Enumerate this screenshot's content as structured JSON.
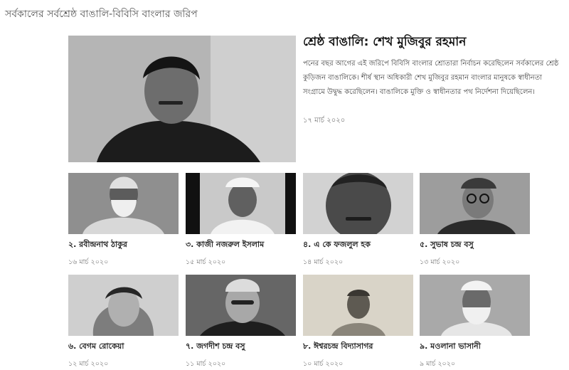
{
  "section": {
    "title": "সর্বকালের সর্বশ্রেষ্ঠ বাঙালি-বিবিসি বাংলার জরিপ"
  },
  "featured": {
    "title": "শ্রেষ্ঠ বাঙালি: শেখ মুজিবুর রহমান",
    "summary": "পনের বছর আগের এই জরিপে বিবিসি বাংলার শ্রোতারা নির্বাচন করেছিলেন সর্বকালের শ্রেষ্ঠ কুড়িজন বাঙালিকে। শীর্ষ স্থান অধিকারী শেখ মুজিবুর রহমান বাংলার মানুষকে স্বাধীনতা সংগ্রামে উদ্বুদ্ধ করেছিলেন। বাঙালিকে মুক্তি ও স্বাধীনতার পথ নির্দেশনা দিয়েছিলেন।",
    "date": "১৭ মার্চ ২০২০"
  },
  "cards": [
    {
      "caption": "২. রবীন্দ্রনাথ ঠাকুর",
      "date": "১৬ মার্চ ২০২০"
    },
    {
      "caption": "৩. কাজী নজরুল ইসলাম",
      "date": "১৫ মার্চ ২০২০"
    },
    {
      "caption": "৪. এ কে ফজলুল হক",
      "date": "১৪ মার্চ ২০২০"
    },
    {
      "caption": "৫. সুভাষ চন্দ্র বসু",
      "date": "১৩ মার্চ ২০২০"
    },
    {
      "caption": "৬. বেগম রোকেয়া",
      "date": "১২ মার্চ ২০২০"
    },
    {
      "caption": "৭. জগদীশ চন্দ্র বসু",
      "date": "১১ মার্চ ২০২০"
    },
    {
      "caption": "৮. ঈশ্বরচন্দ্র বিদ্যাসাগর",
      "date": "১০ মার্চ ২০২০"
    },
    {
      "caption": "৯. মওলানা ভাসানী",
      "date": "৯ মার্চ ২০২০"
    }
  ]
}
